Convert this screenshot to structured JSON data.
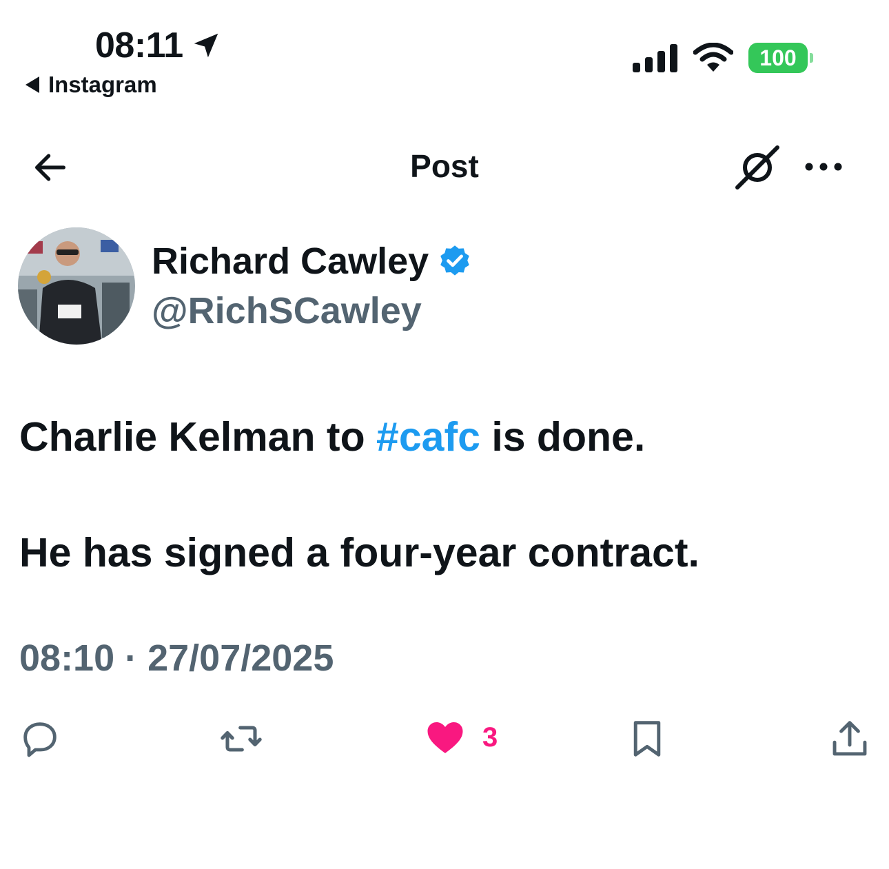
{
  "status_bar": {
    "time": "08:11",
    "back_app": "Instagram",
    "battery": "100"
  },
  "nav": {
    "title": "Post"
  },
  "author": {
    "name": "Richard Cawley",
    "handle": "@RichSCawley",
    "verified": true
  },
  "post": {
    "line1_before": "Charlie Kelman to ",
    "line1_hashtag": "#cafc",
    "line1_after": " is done.",
    "line2": "He has signed a four-year contract.",
    "timestamp": "08:10 · 27/07/2025"
  },
  "actions": {
    "likes": "3"
  },
  "colors": {
    "accent": "#1d9bf0",
    "like": "#f91880",
    "muted": "#536471",
    "battery": "#34c759"
  }
}
